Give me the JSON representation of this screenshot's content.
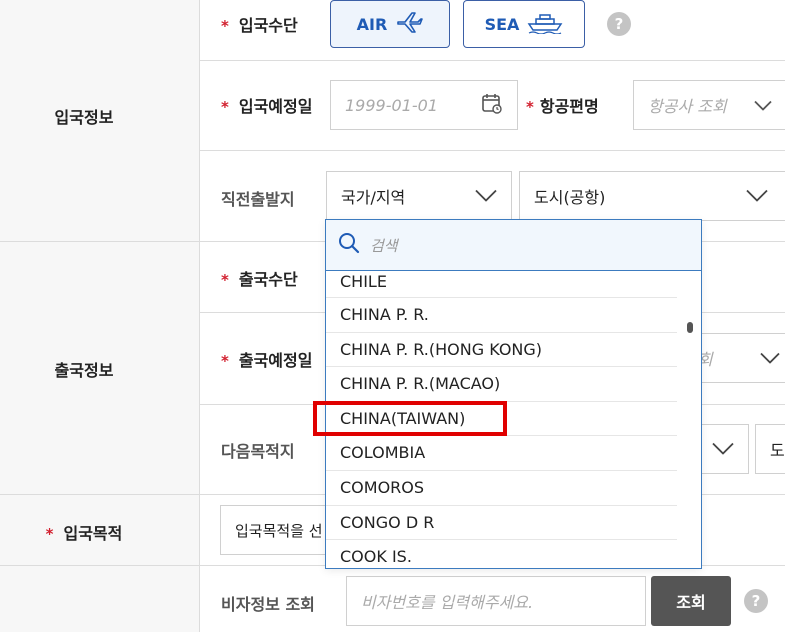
{
  "sections": {
    "arrival": "입국정보",
    "departure": "출국정보",
    "purpose": "입국목적"
  },
  "required_mark": "*",
  "arrival": {
    "transport_label": "입국수단",
    "transport_options": {
      "air": "AIR",
      "sea": "SEA"
    },
    "help": "?",
    "date_label": "입국예정일",
    "date_placeholder": "1999-01-01",
    "flight_label": "항공편명",
    "flight_placeholder": "항공사 조회",
    "origin_label": "직전출발지",
    "country_select": "국가/지역",
    "city_select": "도시(공항)"
  },
  "departure": {
    "transport_label": "출국수단",
    "date_label": "출국예정일",
    "partial_placeholder": "회",
    "next_dest_label": "다음목적지",
    "city_partial": "도시"
  },
  "purpose": {
    "select_partial": "입국목적을 선"
  },
  "visa": {
    "label": "비자정보 조회",
    "placeholder": "비자번호를 입력해주세요.",
    "search_button": "조회",
    "help": "?"
  },
  "dropdown": {
    "search_placeholder": "검색",
    "items": [
      "CHILE",
      "CHINA P. R.",
      "CHINA P. R.(HONG KONG)",
      "CHINA P. R.(MACAO)",
      "CHINA(TAIWAN)",
      "COLOMBIA",
      "COMOROS",
      "CONGO D R",
      "COOK IS."
    ],
    "highlighted_item": "CHINA(TAIWAN)"
  },
  "colors": {
    "accent": "#1f5bb5",
    "required": "#d2202f",
    "highlight": "#e00000",
    "dropdown_border": "#3c7bbf"
  },
  "icons": [
    "plane-icon",
    "ship-icon",
    "calendar-icon",
    "chevron-down-icon",
    "search-icon",
    "help-icon"
  ]
}
